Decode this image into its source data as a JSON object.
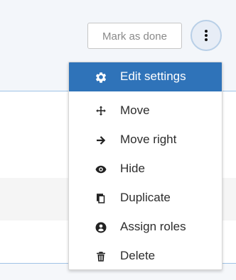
{
  "completion": {
    "mark_done_label": "Mark as done"
  },
  "menu": {
    "items": [
      {
        "label": "Edit settings",
        "icon": "gear-icon"
      },
      {
        "label": "Move",
        "icon": "move-icon"
      },
      {
        "label": "Move right",
        "icon": "arrow-right-icon"
      },
      {
        "label": "Hide",
        "icon": "eye-icon"
      },
      {
        "label": "Duplicate",
        "icon": "duplicate-icon"
      },
      {
        "label": "Assign roles",
        "icon": "user-circle-icon"
      },
      {
        "label": "Delete",
        "icon": "trash-icon"
      }
    ],
    "active_color": "#2f73b9"
  }
}
